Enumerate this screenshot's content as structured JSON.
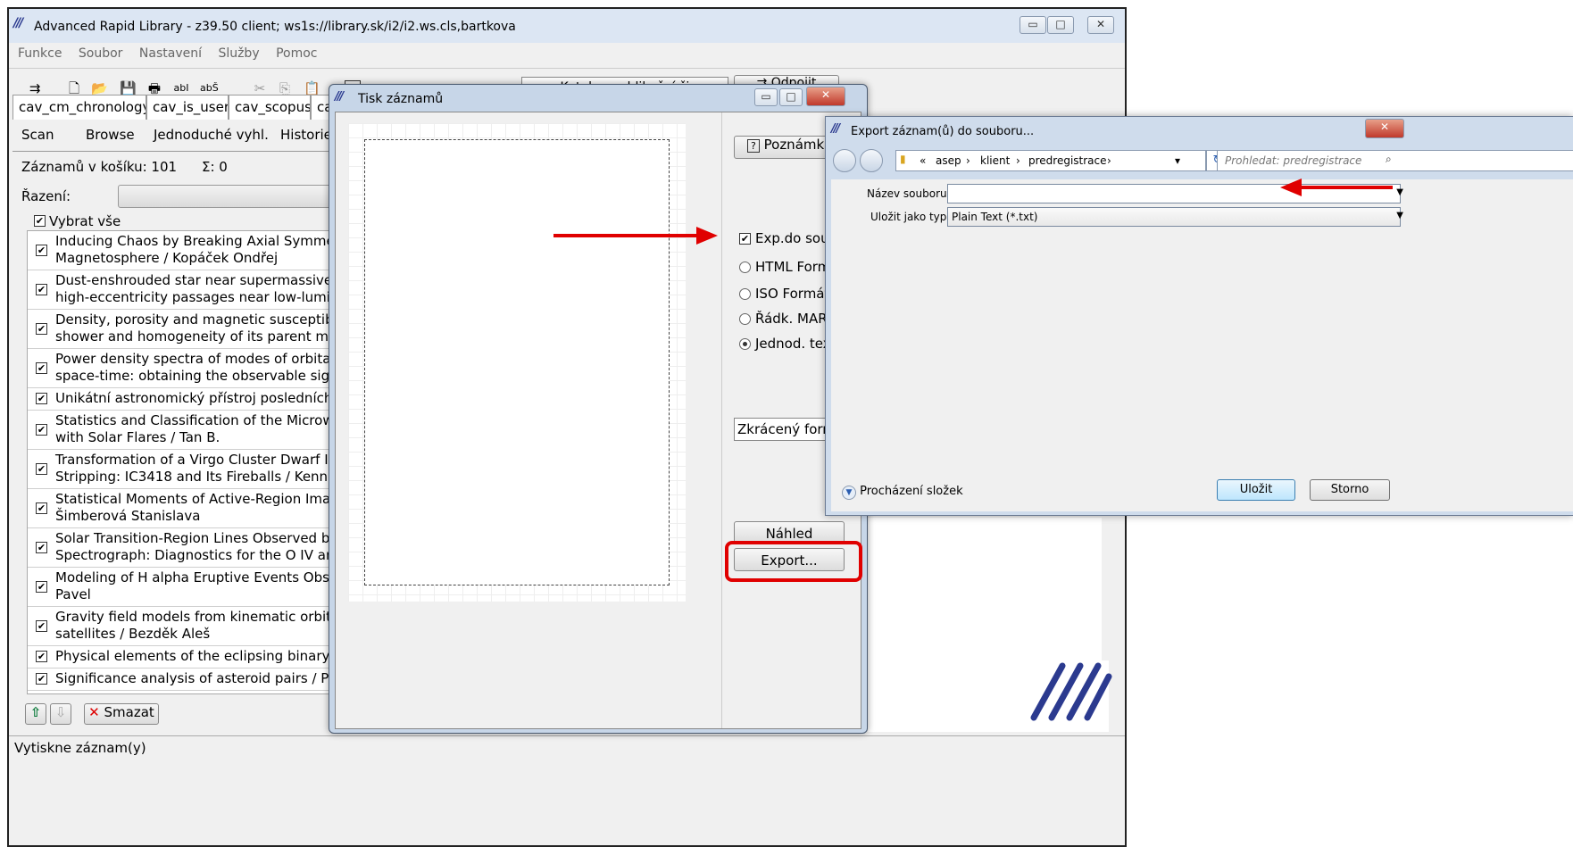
{
  "main_window": {
    "title": "Advanced Rapid Library - z39.50 client; ws1s://library.sk/i2/i2.ws.cls,bartkova",
    "menu": [
      "Funkce",
      "Soubor",
      "Nastavení",
      "Služby",
      "Pomoc"
    ],
    "toolbar_right": {
      "catalog_select": "cav - Katalog publikační činno",
      "disconnect_button": "Odpojit"
    },
    "db_tabs": [
      "cav_cm_chronology",
      "cav_is_user",
      "cav_scopus",
      "ca"
    ],
    "view_tabs": [
      "Scan",
      "Browse",
      "Jednoduché vyhl.",
      "Historie"
    ],
    "basket_count": "Záznamů v košíku: 101",
    "sum_label": "Σ: 0",
    "sort_label": "Řazení:",
    "select_all": "Vybrat vše",
    "records": [
      {
        "line1": "Inducing Chaos by Breaking Axial Symmetry i",
        "line2": "Magnetosphere / Kopáček Ondřej"
      },
      {
        "line1": "Dust-enshrouded star near supermassive bla",
        "line2": "high-eccentricity passages near low-luminosi"
      },
      {
        "line1": "Density, porosity and magnetic susceptibility",
        "line2": "shower and homogeneity of its parent meteo"
      },
      {
        "line1": "Power density spectra of modes of orbital mo",
        "line2": "space-time: obtaining the observable signal /"
      },
      {
        "line1": "Unikátní astronomický přístroj posledních Pře",
        "line2": ""
      },
      {
        "line1": "Statistics and Classification of the Microwave",
        "line2": "with Solar Flares / Tan B."
      },
      {
        "line1": "Transformation of a Virgo Cluster Dwarf Irre",
        "line2": "Stripping: IC3418 and Its Fireballs / Kenney J"
      },
      {
        "line1": "Statistical Moments of Active-Region Images",
        "line2": "Šimberová Stanislava"
      },
      {
        "line1": "Solar Transition-Region Lines Observed by th",
        "line2": "Spectrograph: Diagnostics for the O IV and S"
      },
      {
        "line1": "Modeling of H alpha Eruptive Events Observe",
        "line2": "Pavel"
      },
      {
        "line1": "Gravity field models from kinematic orbits of",
        "line2": "satellites / Bezděk Aleš"
      },
      {
        "line1": "Physical elements of the eclipsing binary &#9",
        "line2": ""
      },
      {
        "line1": "Significance analysis of asteroid pairs / Prave",
        "line2": ""
      }
    ],
    "delete_button": "Smazat",
    "status_bar": "Vytiskne záznam(y)"
  },
  "print_dialog": {
    "title": "Tisk záznamů",
    "note_button": "Poznámk",
    "export_checkbox": "Exp.do soub",
    "formats": [
      "HTML Form",
      "ISO Formát",
      "Řádk. MARC",
      "Jednod. tex"
    ],
    "selected_format_index": 3,
    "format_select": "Zkrácený form",
    "preview_button": "Náhled",
    "export_button": "Export..."
  },
  "export_dialog": {
    "title": "Export záznam(ů) do souboru...",
    "breadcrumb": [
      "«",
      "asep",
      "klient",
      "predregistrace"
    ],
    "search_placeholder": "Prohledat: predregistrace",
    "filename_label": "Název souboru:",
    "filename_value": "",
    "filetype_label": "Uložit jako typ:",
    "filetype_value": "Plain Text (*.txt)",
    "browse_folders": "Procházení složek",
    "save_button": "Uložit",
    "cancel_button": "Storno"
  },
  "colors": {
    "highlight_red": "#e00000",
    "title_blue": "#dce6f3",
    "logo_blue": "#2b3a8f"
  }
}
